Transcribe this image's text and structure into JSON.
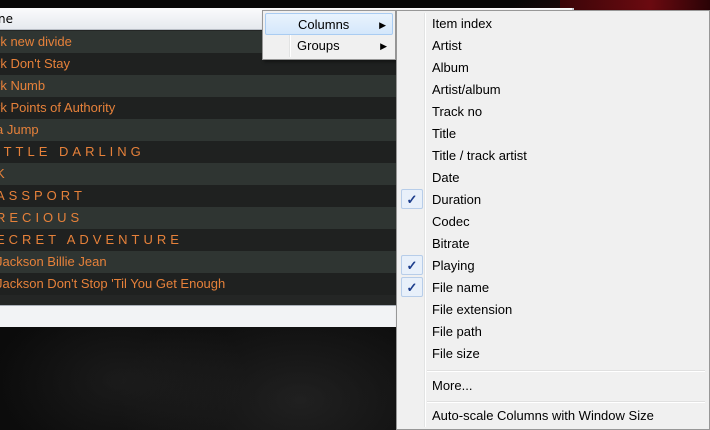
{
  "playlist": {
    "header_label": "ne",
    "rows": [
      {
        "text": "rk new divide",
        "spaced": false
      },
      {
        "text": "rk Don't Stay",
        "spaced": false
      },
      {
        "text": "rk Numb",
        "spaced": false
      },
      {
        "text": "rk Points of Authority",
        "spaced": false
      },
      {
        "text": "a Jump",
        "spaced": false
      },
      {
        "text": "ITTLE DARLING",
        "spaced": true
      },
      {
        "text": "K",
        "spaced": true
      },
      {
        "text": "ASSPORT",
        "spaced": true
      },
      {
        "text": "RECIOUS",
        "spaced": true
      },
      {
        "text": "ECRET ADVENTURE",
        "spaced": true
      },
      {
        "text": "Jackson Billie Jean",
        "spaced": false
      },
      {
        "text": "Jackson Don't Stop 'Til You Get Enough",
        "spaced": false
      }
    ]
  },
  "context_menu": {
    "items": [
      {
        "label": "Columns",
        "arrow": "▶",
        "highlighted": true
      },
      {
        "label": "Groups",
        "arrow": "▶",
        "highlighted": false
      }
    ]
  },
  "columns_menu": {
    "check_glyph": "✓",
    "items": [
      {
        "label": "Item index",
        "checked": false
      },
      {
        "label": "Artist",
        "checked": false
      },
      {
        "label": "Album",
        "checked": false
      },
      {
        "label": "Artist/album",
        "checked": false
      },
      {
        "label": "Track no",
        "checked": false
      },
      {
        "label": "Title",
        "checked": false
      },
      {
        "label": "Title / track artist",
        "checked": false
      },
      {
        "label": "Date",
        "checked": false
      },
      {
        "label": "Duration",
        "checked": true
      },
      {
        "label": "Codec",
        "checked": false
      },
      {
        "label": "Bitrate",
        "checked": false
      },
      {
        "label": "Playing",
        "checked": true
      },
      {
        "label": "File name",
        "checked": true
      },
      {
        "label": "File extension",
        "checked": false
      },
      {
        "label": "File path",
        "checked": false
      },
      {
        "label": "File size",
        "checked": false
      }
    ],
    "more_label": "More...",
    "autoscale_label": "Auto-scale Columns with Window Size"
  },
  "colors": {
    "row_text": "#e6813a",
    "menu_bg": "#f0f0f0",
    "check_color": "#1c3d8c"
  }
}
